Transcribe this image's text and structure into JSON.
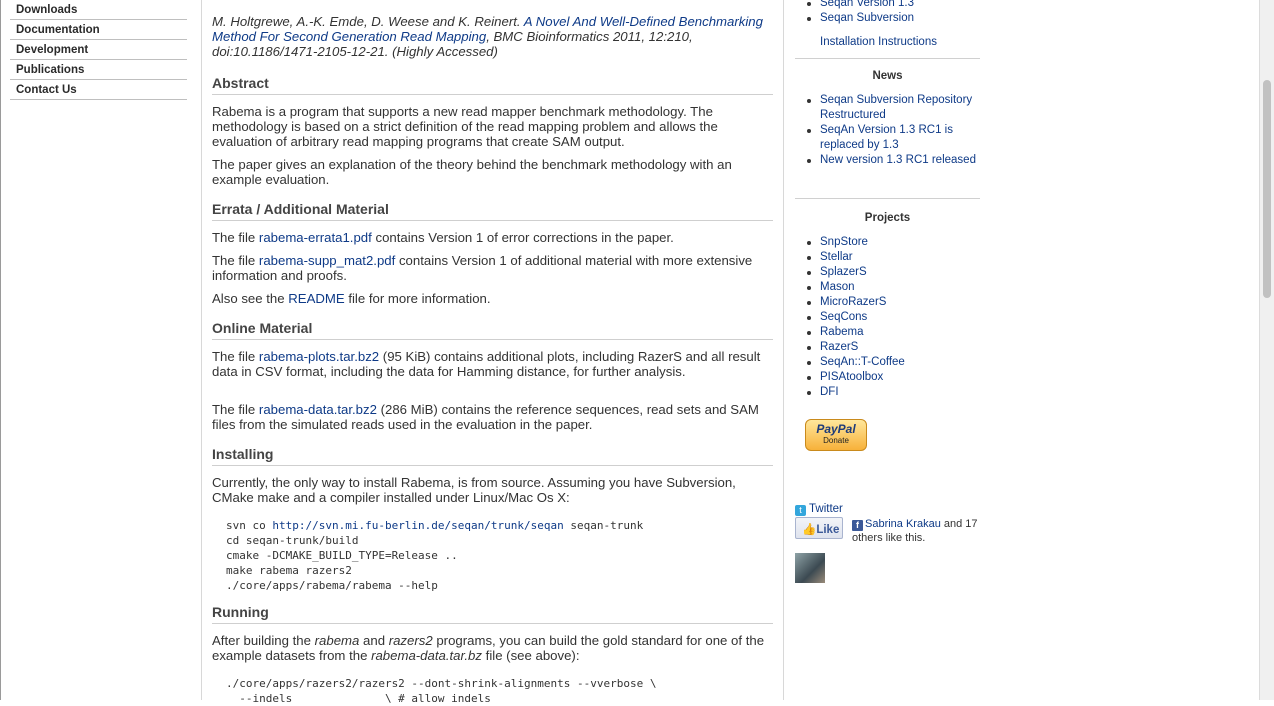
{
  "leftnav": {
    "items": [
      "Downloads",
      "Documentation",
      "Development",
      "Publications",
      "Contact Us"
    ]
  },
  "main": {
    "citation": {
      "authors": "M. Holtgrewe, A.-K. Emde, D. Weese and K. Reinert.",
      "title_link": "A Novel And Well-Defined Benchmarking Method For Second Generation Read Mapping",
      "rest": ", BMC Bioinformatics 2011, 12:210, doi:10.1186/1471-2105-12-21. (Highly Accessed)"
    },
    "abstract": {
      "heading": "Abstract",
      "p1": "Rabema is a program that supports a new read mapper benchmark methodology. The methodology is based on a strict definition of the read mapping problem and allows the evaluation of arbitrary read mapping programs that create SAM output.",
      "p2": "The paper gives an explanation of the theory behind the benchmark methodology with an example evaluation."
    },
    "errata": {
      "heading": "Errata / Additional Material",
      "p1_pre": "The file ",
      "p1_link": "rabema-errata1.pdf",
      "p1_post": " contains Version 1 of error corrections in the paper.",
      "p2_pre": "The file ",
      "p2_link": "rabema-supp_mat2.pdf",
      "p2_post": " contains Version 1 of additional material with more extensive information and proofs.",
      "p3_pre": "Also see the ",
      "p3_link": "README",
      "p3_post": " file for more information."
    },
    "online": {
      "heading": "Online Material",
      "p1_pre": "The file ",
      "p1_link": "rabema-plots.tar.bz2",
      "p1_post": " (95 KiB) contains additional plots, including RazerS and all result data in CSV format, including the data for Hamming distance, for further analysis.",
      "p2_pre": "The file ",
      "p2_link": "rabema-data.tar.bz2",
      "p2_post": " (286 MiB) contains the reference sequences, read sets and SAM files from the simulated reads used in the evaluation in the paper."
    },
    "installing": {
      "heading": "Installing",
      "p1": "Currently, the only way to install Rabema, is from source. Assuming you have Subversion, CMake make and a compiler installed under Linux/Mac Os X:",
      "code_l1_pre": "svn co ",
      "code_l1_link": "http://svn.mi.fu-berlin.de/seqan/trunk/seqan",
      "code_l1_post": " seqan-trunk",
      "code_rest": "cd seqan-trunk/build\ncmake -DCMAKE_BUILD_TYPE=Release ..\nmake rabema razers2\n./core/apps/rabema/rabema --help"
    },
    "running": {
      "heading": "Running",
      "p1_a": "After building the ",
      "p1_em1": "rabema",
      "p1_b": " and ",
      "p1_em2": "razers2",
      "p1_c": " programs, you can build the gold standard for one of the example datasets from the ",
      "p1_em3": "rabema-data.tar.bz",
      "p1_d": " file (see above):",
      "code": "./core/apps/razers2/razers2 --dont-shrink-alignments --vverbose \\\n  --indels              \\ # allow indels"
    }
  },
  "sidebar": {
    "top_links": [
      "Seqan Version 1.3",
      "Seqan Subversion"
    ],
    "install_link": "Installation Instructions",
    "news_heading": "News",
    "news": [
      "Seqan Subversion Repository Restructured",
      "SeqAn Version 1.3 RC1 is replaced by 1.3",
      "New version 1.3 RC1 released"
    ],
    "projects_heading": "Projects",
    "projects": [
      "SnpStore",
      "Stellar",
      "SplazerS",
      "Mason",
      "MicroRazerS",
      "SeqCons",
      "Rabema",
      "RazerS",
      "SeqAn::T-Coffee",
      "PISAtoolbox",
      "DFI"
    ],
    "paypal_brand": "PayPal",
    "paypal_label": "Donate",
    "twitter_icon": "twitter-icon",
    "twitter_label": "Twitter",
    "like_label": "Like",
    "fb_name": "Sabrina Krakau",
    "fb_rest": " and 17 others like this."
  },
  "colors": {
    "link": "#0e3a87",
    "text": "#333333",
    "scroll_thumb": "#c1c1c1"
  }
}
